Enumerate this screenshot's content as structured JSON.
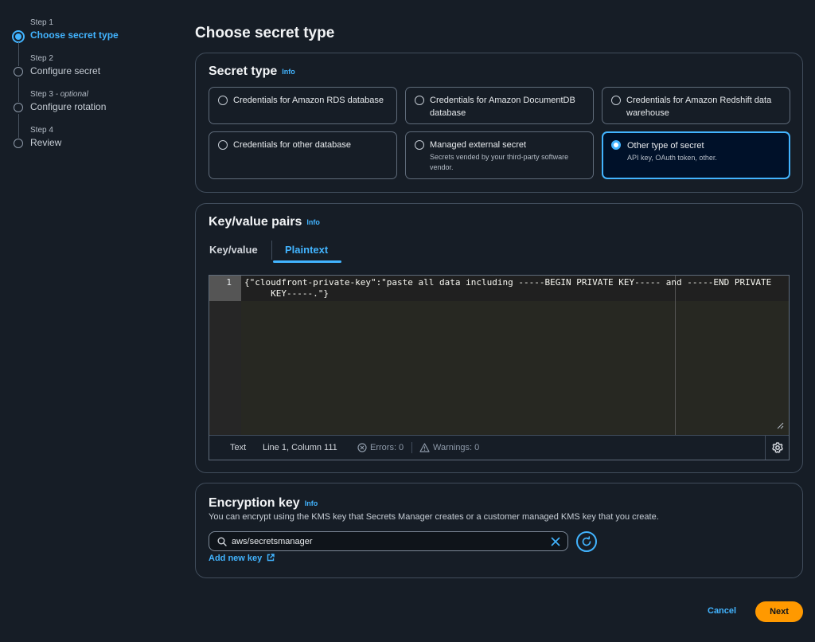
{
  "steps": [
    {
      "num": "Step 1",
      "title": "Choose secret type"
    },
    {
      "num": "Step 2",
      "title": "Configure secret"
    },
    {
      "num": "Step 3",
      "num_suffix": " - optional",
      "title": "Configure rotation"
    },
    {
      "num": "Step 4",
      "title": "Review"
    }
  ],
  "page_title": "Choose secret type",
  "secret_type": {
    "heading": "Secret type",
    "info": "Info",
    "options": [
      {
        "label": "Credentials for Amazon RDS database",
        "desc": ""
      },
      {
        "label": "Credentials for Amazon DocumentDB database",
        "desc": ""
      },
      {
        "label": "Credentials for Amazon Redshift data warehouse",
        "desc": ""
      },
      {
        "label": "Credentials for other database",
        "desc": ""
      },
      {
        "label": "Managed external secret",
        "desc": "Secrets vended by your third-party software vendor."
      },
      {
        "label": "Other type of secret",
        "desc": "API key, OAuth token, other."
      }
    ],
    "selected_index": 5
  },
  "kv": {
    "heading": "Key/value pairs",
    "info": "Info",
    "tabs": [
      "Key/value",
      "Plaintext"
    ],
    "active_tab": "Plaintext",
    "line_number": "1",
    "code": "{\"cloudfront-private-key\":\"paste all data including -----BEGIN PRIVATE KEY----- and -----END PRIVATE\n     KEY-----.\"}",
    "status": {
      "mode": "Text",
      "position": "Line 1, Column 111",
      "errors": "Errors: 0",
      "warnings": "Warnings: 0"
    }
  },
  "encryption": {
    "heading": "Encryption key",
    "info": "Info",
    "description": "You can encrypt using the KMS key that Secrets Manager creates or a customer managed KMS key that you create.",
    "value": "aws/secretsmanager",
    "add_link": "Add new key"
  },
  "footer": {
    "cancel": "Cancel",
    "next": "Next"
  },
  "colors": {
    "accent": "#42b4ff",
    "primary_button": "#ff9900",
    "background": "#161d26"
  }
}
